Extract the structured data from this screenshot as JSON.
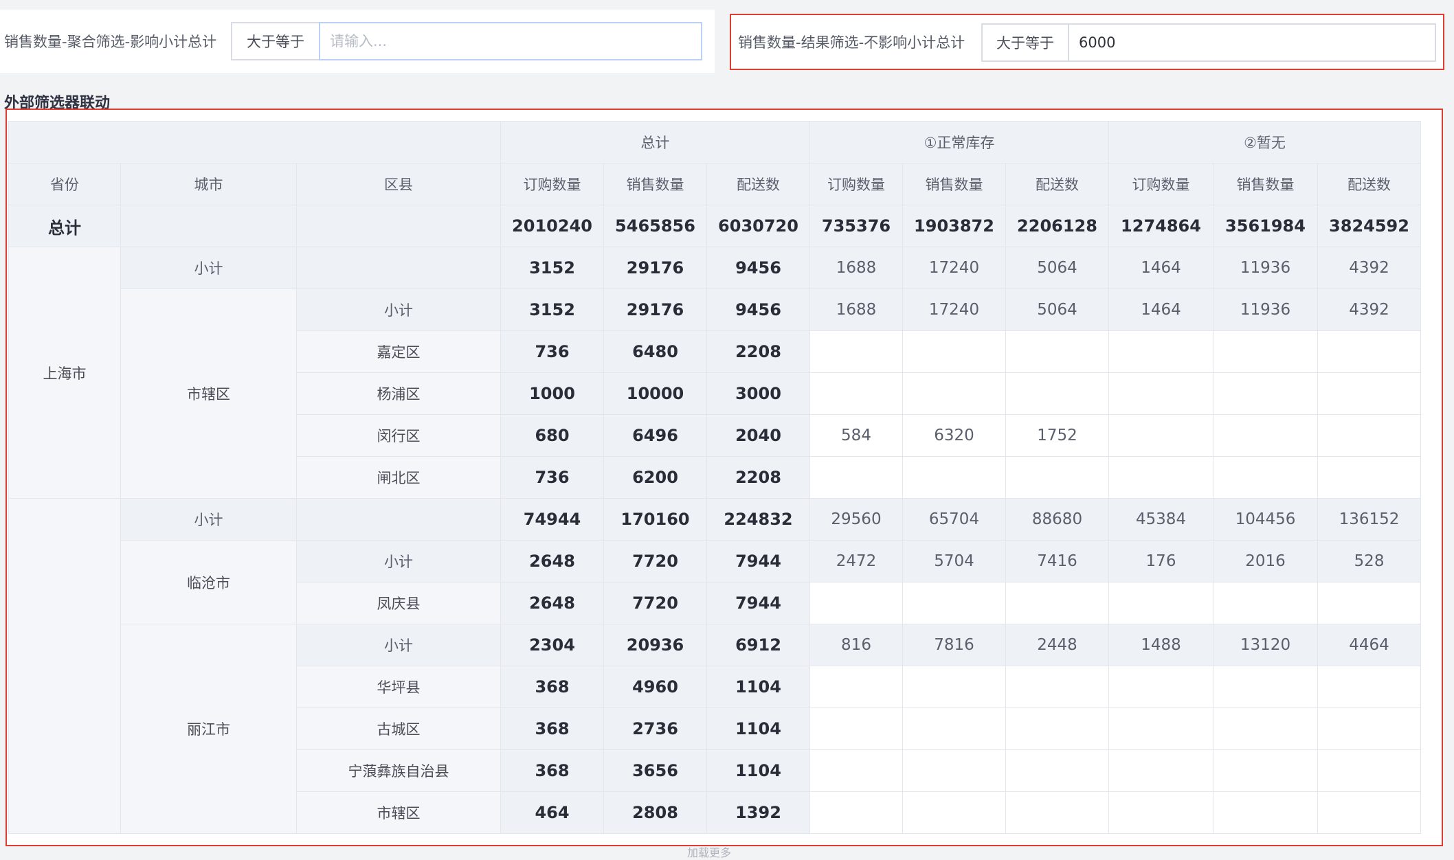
{
  "filters": {
    "left": {
      "label": "销售数量-聚合筛选-影响小计总计",
      "operator": "大于等于",
      "value": "",
      "placeholder": "请输入..."
    },
    "right": {
      "label": "销售数量-结果筛选-不影响小计总计",
      "operator": "大于等于",
      "value": "6000",
      "placeholder": ""
    }
  },
  "section_title": "外部筛选器联动",
  "table": {
    "row_headers": {
      "province": "省份",
      "city": "城市",
      "district": "区县"
    },
    "column_groups": [
      "总计",
      "①正常库存",
      "②暂无"
    ],
    "measures": [
      "订购数量",
      "销售数量",
      "配送数"
    ],
    "grand_total": {
      "label": "总计",
      "values": [
        "2010240",
        "5465856",
        "6030720",
        "735376",
        "1903872",
        "2206128",
        "1274864",
        "3561984",
        "3824592"
      ]
    },
    "subtotal_label": "小计",
    "rows": [
      {
        "province": "上海市",
        "city": "",
        "district": "",
        "subtotal": "city",
        "values": [
          "3152",
          "29176",
          "9456",
          "1688",
          "17240",
          "5064",
          "1464",
          "11936",
          "4392"
        ]
      },
      {
        "province": "",
        "city": "市辖区",
        "district": "小计",
        "subtotal": "district",
        "values": [
          "3152",
          "29176",
          "9456",
          "1688",
          "17240",
          "5064",
          "1464",
          "11936",
          "4392"
        ]
      },
      {
        "district": "嘉定区",
        "values": [
          "736",
          "6480",
          "2208",
          "",
          "",
          "",
          "",
          "",
          ""
        ]
      },
      {
        "district": "杨浦区",
        "values": [
          "1000",
          "10000",
          "3000",
          "",
          "",
          "",
          "",
          "",
          ""
        ]
      },
      {
        "district": "闵行区",
        "values": [
          "680",
          "6496",
          "2040",
          "584",
          "6320",
          "1752",
          "",
          "",
          ""
        ]
      },
      {
        "district": "闸北区",
        "values": [
          "736",
          "6200",
          "2208",
          "",
          "",
          "",
          "",
          "",
          ""
        ]
      },
      {
        "subtotal": "city",
        "values": [
          "74944",
          "170160",
          "224832",
          "29560",
          "65704",
          "88680",
          "45384",
          "104456",
          "136152"
        ]
      },
      {
        "city": "临沧市",
        "district": "小计",
        "subtotal": "district",
        "values": [
          "2648",
          "7720",
          "7944",
          "2472",
          "5704",
          "7416",
          "176",
          "2016",
          "528"
        ]
      },
      {
        "district": "凤庆县",
        "values": [
          "2648",
          "7720",
          "7944",
          "",
          "",
          "",
          "",
          "",
          ""
        ]
      },
      {
        "city": "丽江市",
        "district": "小计",
        "subtotal": "district",
        "values": [
          "2304",
          "20936",
          "6912",
          "816",
          "7816",
          "2448",
          "1488",
          "13120",
          "4464"
        ]
      },
      {
        "district": "华坪县",
        "values": [
          "368",
          "4960",
          "1104",
          "",
          "",
          "",
          "",
          "",
          ""
        ]
      },
      {
        "district": "古城区",
        "values": [
          "368",
          "2736",
          "1104",
          "",
          "",
          "",
          "",
          "",
          ""
        ]
      },
      {
        "district": "宁蒗彝族自治县",
        "values": [
          "368",
          "3656",
          "1104",
          "",
          "",
          "",
          "",
          "",
          ""
        ]
      },
      {
        "district": "市辖区",
        "values": [
          "464",
          "2808",
          "1392",
          "",
          "",
          "",
          "",
          "",
          ""
        ]
      }
    ]
  },
  "hint": "加载更多"
}
